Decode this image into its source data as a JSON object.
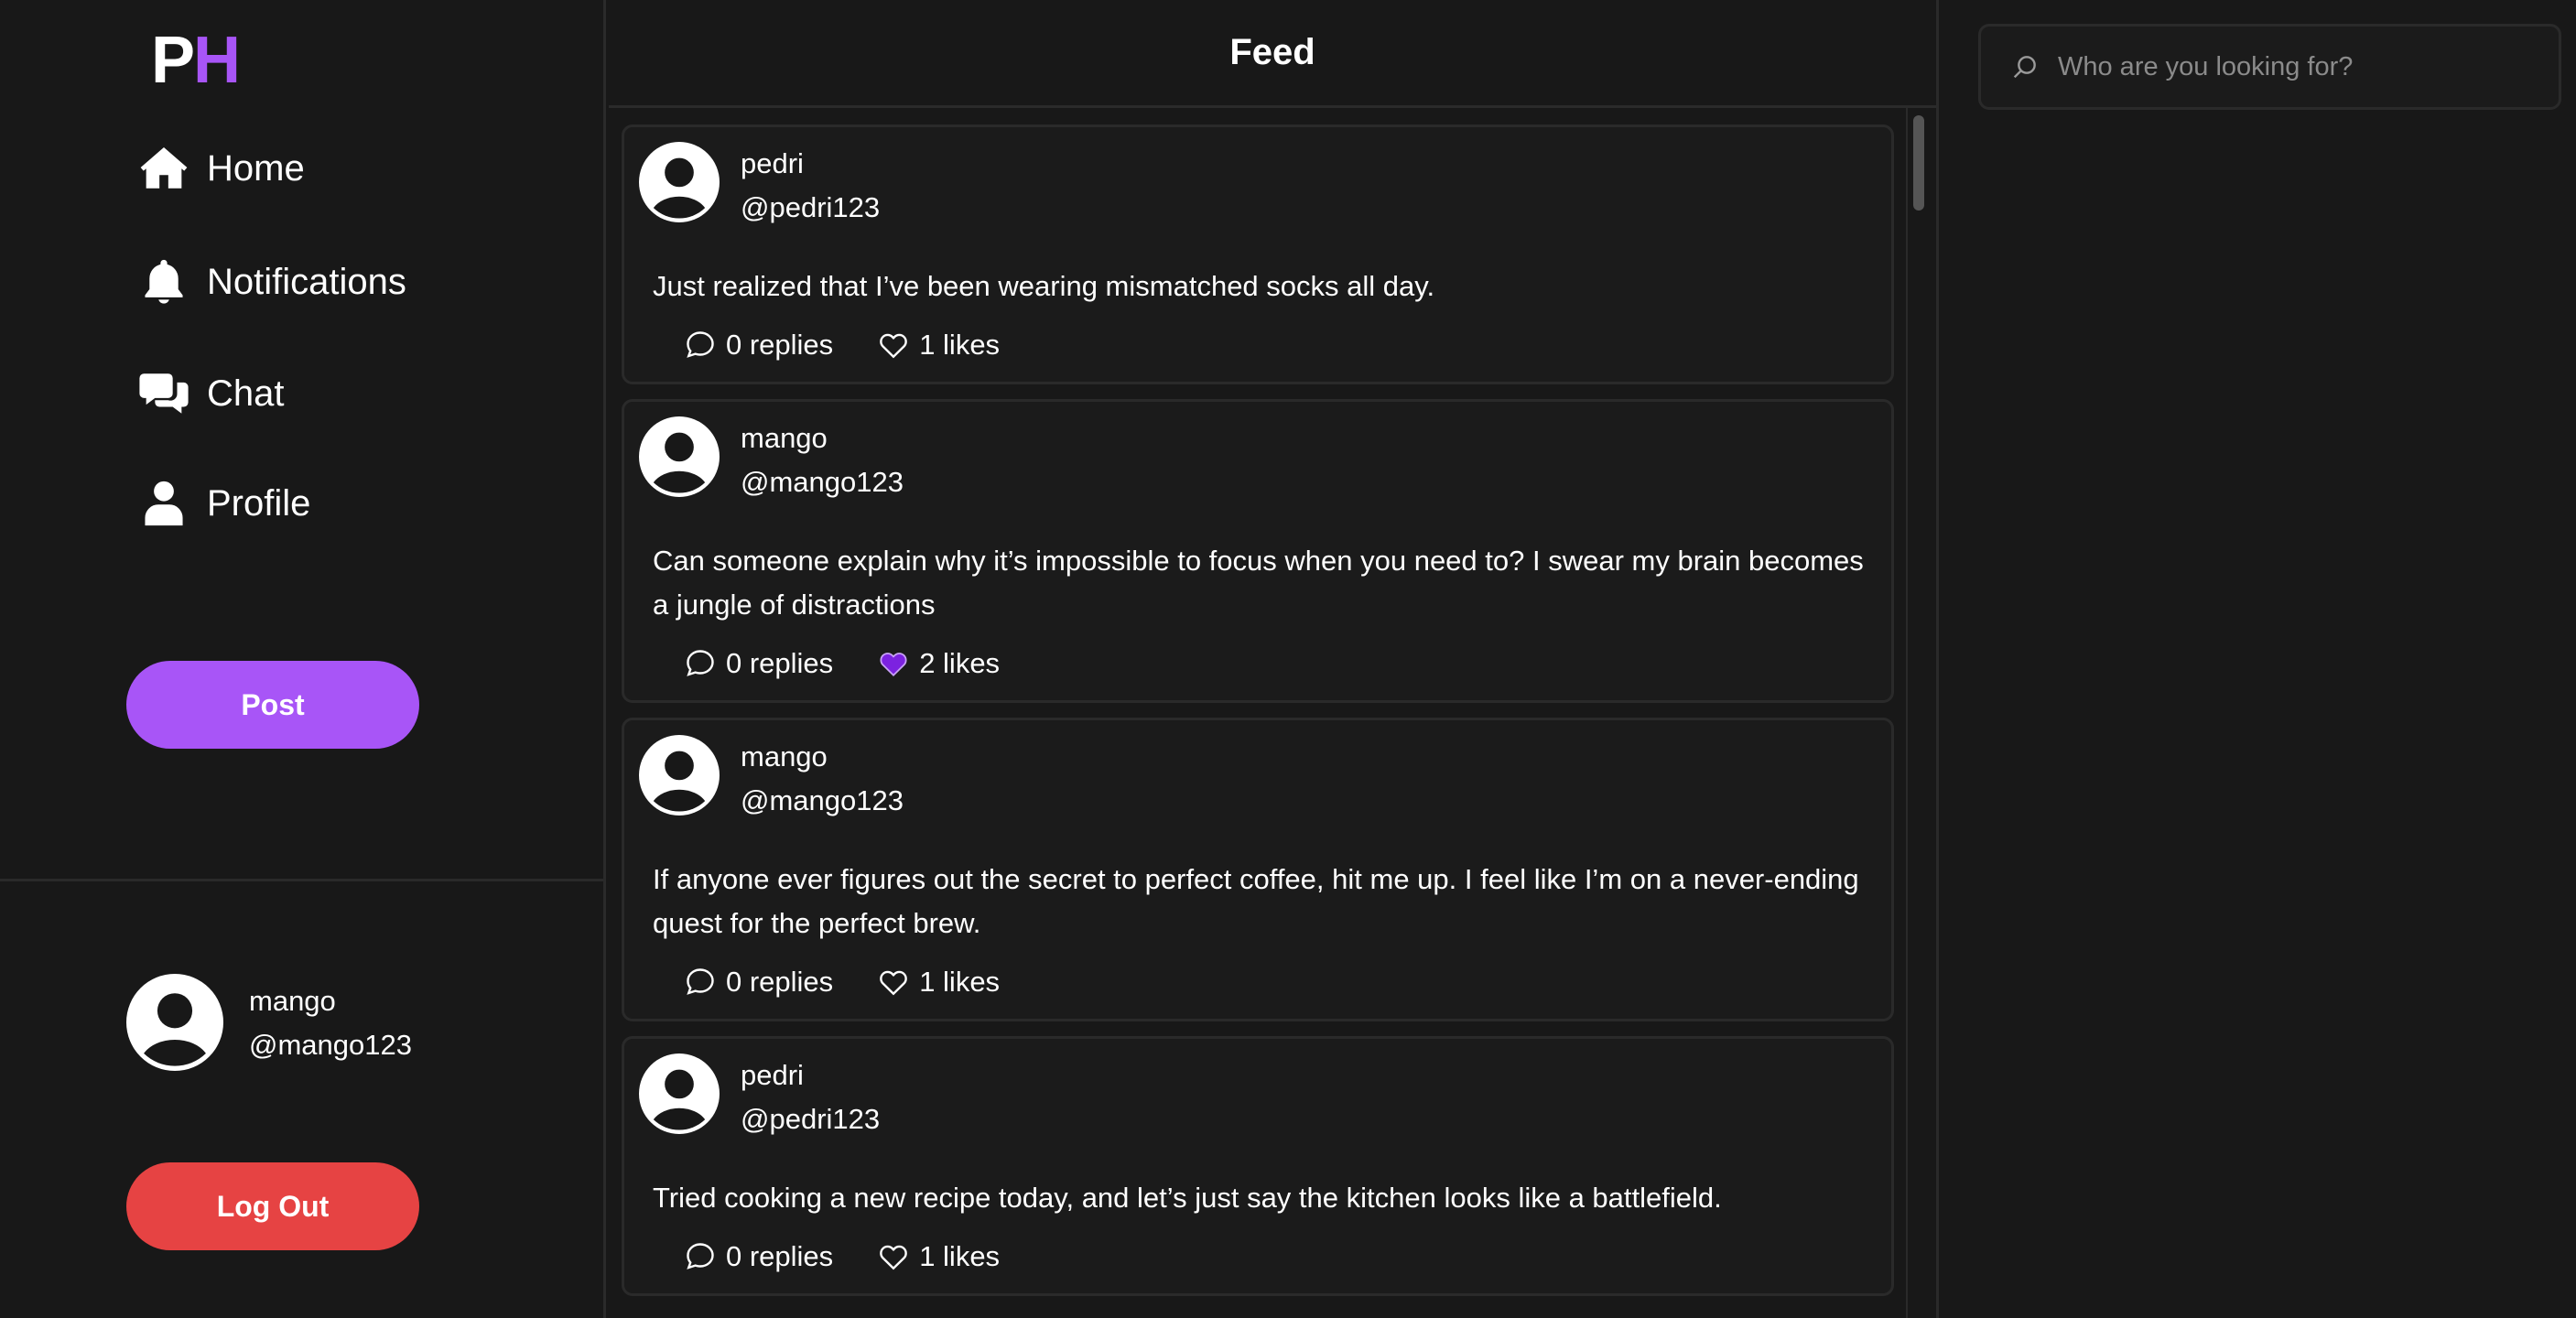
{
  "logo": {
    "p": "P",
    "h": "H"
  },
  "nav": [
    {
      "label": "Home",
      "icon": "home-icon"
    },
    {
      "label": "Notifications",
      "icon": "bell-icon"
    },
    {
      "label": "Chat",
      "icon": "chat-bubbles-icon"
    },
    {
      "label": "Profile",
      "icon": "user-icon"
    }
  ],
  "post_button": "Post",
  "current_user": {
    "name": "mango",
    "handle": "@mango123"
  },
  "logout_button": "Log Out",
  "feed": {
    "title": "Feed",
    "posts": [
      {
        "name": "pedri",
        "handle": "@pedri123",
        "text": "Just realized that I’ve been wearing mismatched socks all day.",
        "replies": "0 replies",
        "likes": "1 likes",
        "liked": false
      },
      {
        "name": "mango",
        "handle": "@mango123",
        "text": "Can someone explain why it’s impossible to focus when you need to? I swear my brain becomes a jungle of distractions",
        "replies": "0 replies",
        "likes": "2 likes",
        "liked": true
      },
      {
        "name": "mango",
        "handle": "@mango123",
        "text": "If anyone ever figures out the secret to perfect coffee, hit me up. I feel like I’m on a never-ending quest for the perfect brew.",
        "replies": "0 replies",
        "likes": "1 likes",
        "liked": false
      },
      {
        "name": "pedri",
        "handle": "@pedri123",
        "text": "Tried cooking a new recipe today, and let’s just say the kitchen looks like a battlefield.",
        "replies": "0 replies",
        "likes": "1 likes",
        "liked": false
      }
    ]
  },
  "search": {
    "placeholder": "Who are you looking for?"
  },
  "colors": {
    "accent": "#a855f7",
    "danger": "#e64343",
    "like_filled": "#7c22e0",
    "background": "#181818"
  }
}
